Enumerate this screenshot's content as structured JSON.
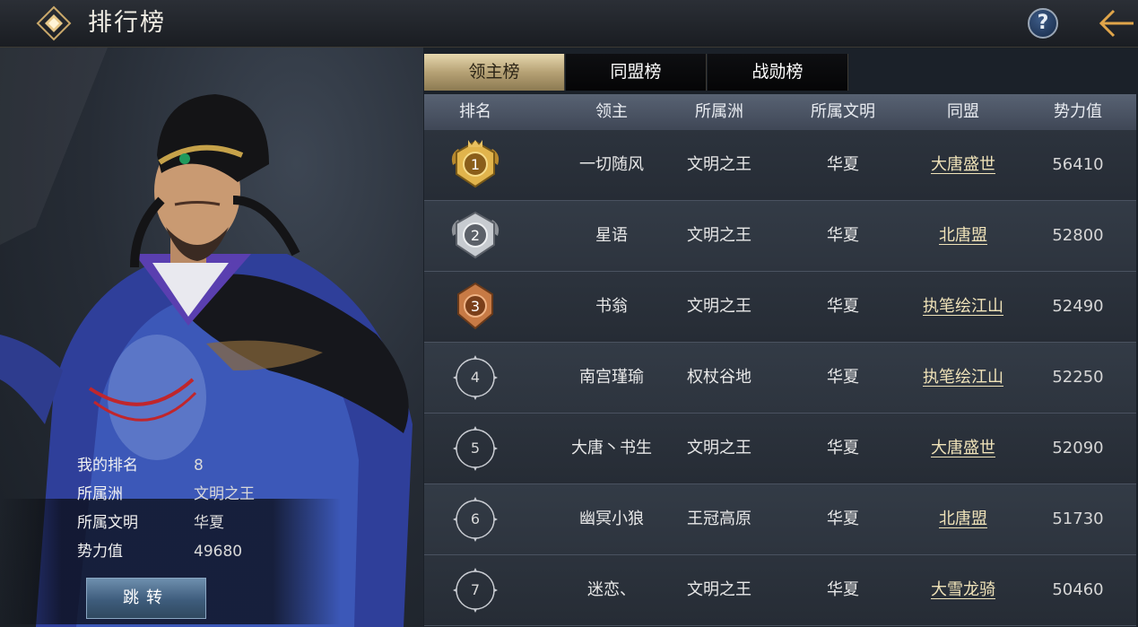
{
  "header": {
    "title": "排行榜",
    "help_label": "?"
  },
  "my_info": {
    "rank_label": "我的排名",
    "rank_value": "8",
    "continent_label": "所属洲",
    "continent_value": "文明之王",
    "civ_label": "所属文明",
    "civ_value": "华夏",
    "power_label": "势力值",
    "power_value": "49680"
  },
  "jump_button": "跳转",
  "tabs": [
    {
      "label": "领主榜",
      "active": true
    },
    {
      "label": "同盟榜",
      "active": false
    },
    {
      "label": "战勋榜",
      "active": false
    }
  ],
  "columns": [
    "排名",
    "领主",
    "所属洲",
    "所属文明",
    "同盟",
    "势力值"
  ],
  "rows": [
    {
      "rank": "1",
      "lord": "一切随风",
      "continent": "文明之王",
      "civ": "华夏",
      "alliance": "大唐盛世",
      "power": "56410",
      "badge": "gold"
    },
    {
      "rank": "2",
      "lord": "星语",
      "continent": "文明之王",
      "civ": "华夏",
      "alliance": "北唐盟",
      "power": "52800",
      "badge": "silver"
    },
    {
      "rank": "3",
      "lord": "书翁",
      "continent": "文明之王",
      "civ": "华夏",
      "alliance": "执笔绘江山",
      "power": "52490",
      "badge": "bronze"
    },
    {
      "rank": "4",
      "lord": "南宫瑾瑜",
      "continent": "权杖谷地",
      "civ": "华夏",
      "alliance": "执笔绘江山",
      "power": "52250",
      "badge": "plain"
    },
    {
      "rank": "5",
      "lord": "大唐丶书生",
      "continent": "文明之王",
      "civ": "华夏",
      "alliance": "大唐盛世",
      "power": "52090",
      "badge": "plain"
    },
    {
      "rank": "6",
      "lord": "幽冥小狼",
      "continent": "王冠高原",
      "civ": "华夏",
      "alliance": "北唐盟",
      "power": "51730",
      "badge": "plain"
    },
    {
      "rank": "7",
      "lord": "迷恋、",
      "continent": "文明之王",
      "civ": "华夏",
      "alliance": "大雪龙骑",
      "power": "50460",
      "badge": "plain"
    }
  ],
  "colors": {
    "accent_gold": "#c9a86a",
    "active_tab": "#b6a275",
    "alliance_link": "#f0e3b9"
  }
}
